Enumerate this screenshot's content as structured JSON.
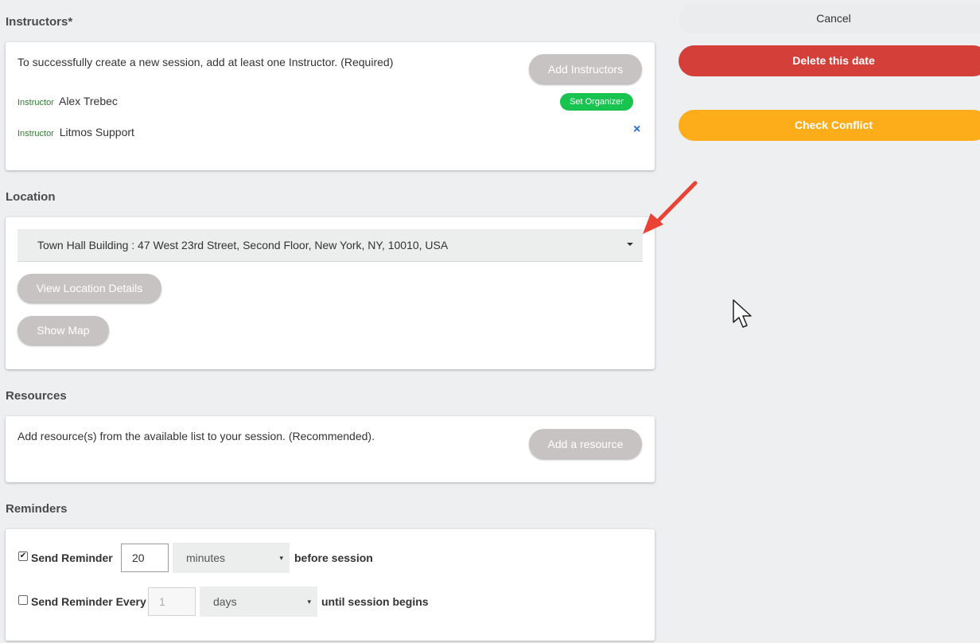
{
  "instructors": {
    "title": "Instructors*",
    "help": "To successfully create a new session, add at least one Instructor. (Required)",
    "add_button": "Add Instructors",
    "items": [
      {
        "role": "Instructor",
        "name": "Alex Trebec",
        "action": "Set Organizer"
      },
      {
        "role": "Instructor",
        "name": "Litmos Support",
        "action": "×"
      }
    ]
  },
  "location": {
    "title": "Location",
    "selected": "Town Hall Building : 47 West 23rd Street, Second Floor, New York, NY, 10010, USA",
    "view_details": "View Location Details",
    "show_map": "Show Map"
  },
  "resources": {
    "title": "Resources",
    "help": "Add resource(s) from the available list to your session. (Recommended).",
    "add_button": "Add a resource"
  },
  "reminders": {
    "title": "Reminders",
    "send_reminder": {
      "checked": true,
      "label": "Send Reminder",
      "value": "20",
      "unit": "minutes",
      "suffix": "before session"
    },
    "send_every": {
      "checked": false,
      "label": "Send Reminder Every",
      "value": "1",
      "unit": "days",
      "suffix": "until session begins"
    }
  },
  "actions": {
    "cancel": "Cancel",
    "delete": "Delete this date",
    "check_conflict": "Check Conflict"
  },
  "colors": {
    "delete": "#d43f3a",
    "check_conflict": "#fdad1a",
    "set_organizer": "#19c34f",
    "pill_button": "#c8c3c3",
    "annotation_arrow": "#ea4335"
  },
  "icons": {
    "checkmark": "✔",
    "dropdown": "▾",
    "remove": "×"
  }
}
